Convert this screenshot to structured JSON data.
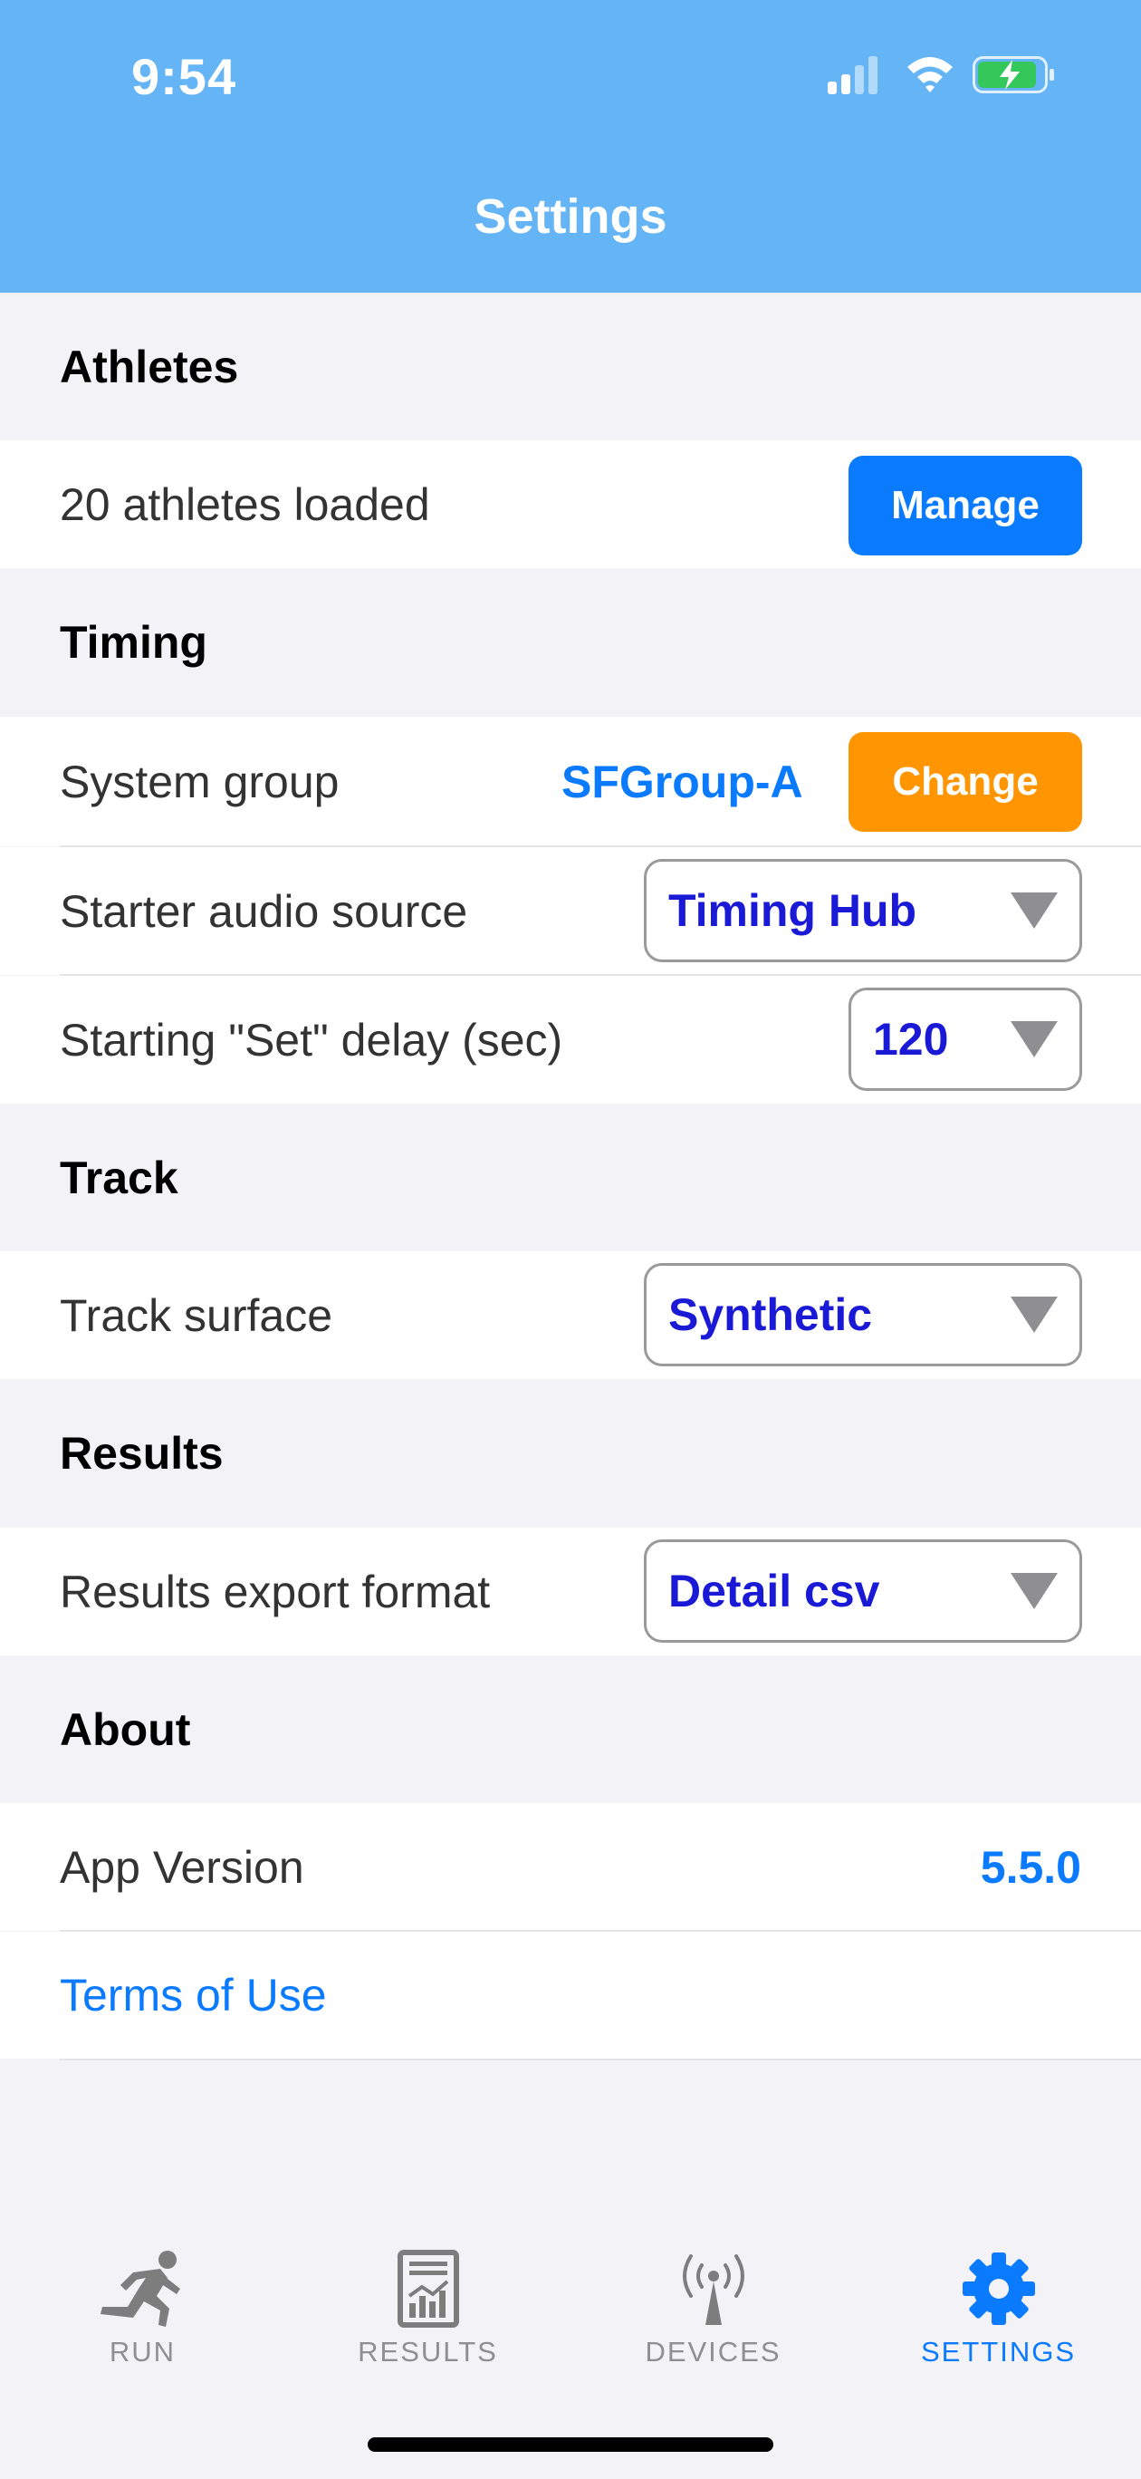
{
  "status_bar": {
    "time": "9:54"
  },
  "header": {
    "title": "Settings"
  },
  "sections": {
    "athletes": {
      "title": "Athletes",
      "loaded_text": "20 athletes loaded",
      "manage_label": "Manage"
    },
    "timing": {
      "title": "Timing",
      "system_group_label": "System group",
      "system_group_value": "SFGroup-A",
      "change_label": "Change",
      "starter_audio_label": "Starter audio source",
      "starter_audio_value": "Timing Hub",
      "set_delay_label": "Starting \"Set\" delay (sec)",
      "set_delay_value": "120"
    },
    "track": {
      "title": "Track",
      "surface_label": "Track surface",
      "surface_value": "Synthetic"
    },
    "results": {
      "title": "Results",
      "export_label": "Results export format",
      "export_value": "Detail csv"
    },
    "about": {
      "title": "About",
      "version_label": "App Version",
      "version_value": "5.5.0",
      "terms_label": "Terms of Use"
    }
  },
  "tabbar": {
    "items": [
      {
        "label": "RUN",
        "icon": "runner-icon"
      },
      {
        "label": "RESULTS",
        "icon": "results-chart-icon"
      },
      {
        "label": "DEVICES",
        "icon": "antenna-icon"
      },
      {
        "label": "SETTINGS",
        "icon": "gear-icon"
      }
    ],
    "active": "SETTINGS"
  },
  "colors": {
    "header_bg": "#64b4f6",
    "accent_blue": "#0a7aff",
    "accent_orange": "#ff9500",
    "dropdown_text": "#1a1ad6"
  }
}
